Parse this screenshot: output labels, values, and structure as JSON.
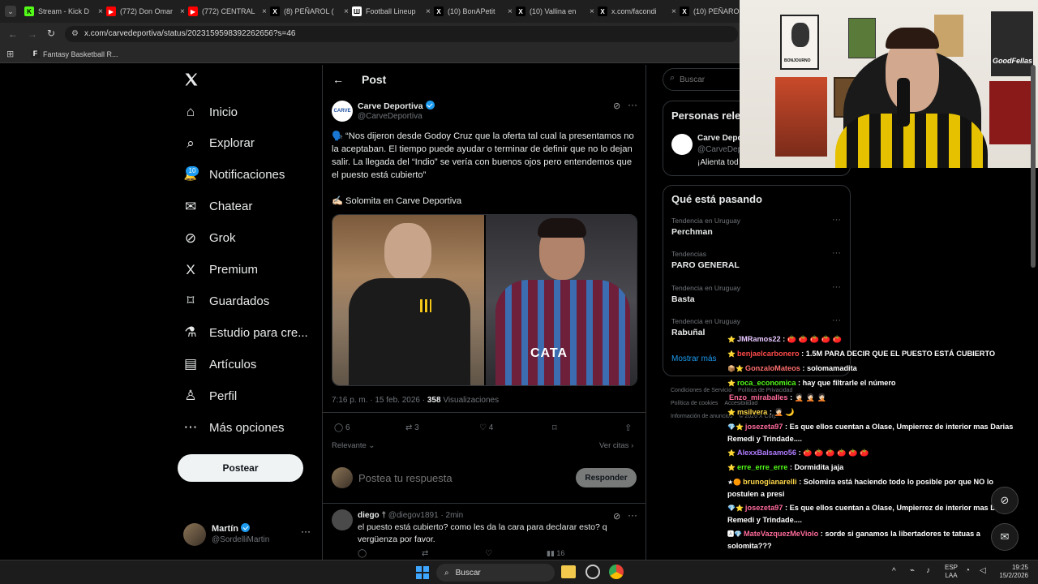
{
  "browser": {
    "tabs": [
      {
        "title": "Stream - Kick D",
        "color": "#53fc18",
        "glyph": "K"
      },
      {
        "title": "(772) Don Omar",
        "color": "#ff0000",
        "glyph": "▶"
      },
      {
        "title": "(772) CENTRAL",
        "color": "#ff0000",
        "glyph": "▶"
      },
      {
        "title": "(8) PEÑAROL (",
        "color": "#000000",
        "glyph": "X"
      },
      {
        "title": "Football Lineup",
        "color": "#ffffff",
        "glyph": "Ш"
      },
      {
        "title": "(10) BonAPetit",
        "color": "#000000",
        "glyph": "X"
      },
      {
        "title": "(10) Vallina en",
        "color": "#000000",
        "glyph": "X"
      },
      {
        "title": "x.com/facondi",
        "color": "#000000",
        "glyph": "X"
      },
      {
        "title": "(10) PEÑAROL",
        "color": "#000000",
        "glyph": "X"
      }
    ],
    "url": "x.com/carvedeportiva/status/2023159598392262656?s=46",
    "bookmark": "Fantasy Basketball R..."
  },
  "sidebar": {
    "items": [
      {
        "label": "Inicio",
        "icon": "home-icon",
        "name": "nav-inicio"
      },
      {
        "label": "Explorar",
        "icon": "search-icon",
        "name": "nav-explorar"
      },
      {
        "label": "Notificaciones",
        "icon": "bell-icon",
        "name": "nav-notificaciones"
      },
      {
        "label": "Chatear",
        "icon": "mail-icon",
        "name": "nav-chatear"
      },
      {
        "label": "Grok",
        "icon": "grok-icon",
        "name": "nav-grok"
      },
      {
        "label": "Premium",
        "icon": "x-logo-icon",
        "name": "nav-premium"
      },
      {
        "label": "Guardados",
        "icon": "bookmark-icon",
        "name": "nav-guardados"
      },
      {
        "label": "Estudio para cre...",
        "icon": "flask-icon",
        "name": "nav-estudio"
      },
      {
        "label": "Artículos",
        "icon": "article-icon",
        "name": "nav-articulos"
      },
      {
        "label": "Perfil",
        "icon": "person-icon",
        "name": "nav-perfil"
      },
      {
        "label": "Más opciones",
        "icon": "more-icon",
        "name": "nav-mas"
      }
    ],
    "notif_badge": "10",
    "post_button": "Postear",
    "account": {
      "name": "Martín",
      "handle": "@SordelliMartin"
    }
  },
  "post": {
    "header_title": "Post",
    "author": "Carve Deportiva",
    "handle": "@CarveDeportiva",
    "avatar_text": "CARVE",
    "body": "🗣️ “Nos dijeron desde Godoy Cruz que la oferta tal cual la presentamos no la aceptaban. El tiempo puede ayudar o terminar de definir que no lo dejan salir. La llegada del “Indio” se vería con buenos ojos pero entendemos que el puesto está cubierto”",
    "source": "✍🏻 Solomita en Carve Deportiva",
    "timestamp": "7:16 p. m. · 15 feb. 2026 · ",
    "views": "358",
    "views_label": " Visualizaciones",
    "replies": "6",
    "reposts": "3",
    "likes": "4",
    "sort_label": "Relevante",
    "quotes_link": "Ver citas",
    "reply_placeholder": "Postea tu respuesta",
    "reply_button": "Responder"
  },
  "reply": {
    "author": "diego",
    "mark": "†",
    "handle": "@diegov1891",
    "time": "· 2min",
    "text": "el puesto está cubierto? como les da la cara para declarar esto? q vergüenza por favor.",
    "views": "16"
  },
  "right": {
    "search_placeholder": "Buscar",
    "people_title": "Personas rele",
    "person_name": "Carve Depo",
    "person_handle": "@CarveDep",
    "person_bio": "¡Alienta tod",
    "trends_title": "Qué está pasando",
    "trends": [
      {
        "context": "Tendencia en Uruguay",
        "name": "Perchman"
      },
      {
        "context": "Tendencias",
        "name": "PARO GENERAL"
      },
      {
        "context": "Tendencia en Uruguay",
        "name": "Basta"
      },
      {
        "context": "Tendencia en Uruguay",
        "name": "Rabuñal"
      }
    ],
    "show_more": "Mostrar más",
    "footer": [
      "Condiciones de Servicio",
      "Política de Privacidad",
      "Política de cookies",
      "Accesibilidad",
      "Información de anuncios",
      "© 2026 X Corp."
    ]
  },
  "chat": [
    {
      "badge": "⭐",
      "user": "JMRamos22",
      "color": "#e8c7ff",
      "msg": "🍅 🍅 🍅 🍅 🍅"
    },
    {
      "badge": "⭐",
      "user": "benjaelcarbonero",
      "color": "#ff4a4a",
      "msg": "1.5M PARA DECIR QUE EL PUESTO ESTÁ CUBIERTO"
    },
    {
      "badge": "📦⭐",
      "user": "GonzaloMateos",
      "color": "#ff6f6f",
      "msg": "solomamadita"
    },
    {
      "badge": "⭐",
      "user": "roca_economica",
      "color": "#53fc18",
      "msg": "hay que filtrarle el número"
    },
    {
      "badge": "",
      "user": "Enzo_miraballes",
      "color": "#ff6b9b",
      "msg": "🤦🏻 🤦🏻 🤦🏻"
    },
    {
      "badge": "⭐",
      "user": "msilvera",
      "color": "#ffd84a",
      "msg": "🤦🏻 🌙"
    },
    {
      "badge": "💎⭐",
      "user": "josezeta97",
      "color": "#ff6b9b",
      "msg": "Es que ellos cuentan a Olase, Umpierrez de interior mas Darias Remedi y Trindade...."
    },
    {
      "badge": "⭐",
      "user": "AlexxBalsamo56",
      "color": "#b07cff",
      "msg": "🍅 🍅 🍅 🍅 🍅 🍅"
    },
    {
      "badge": "⭐",
      "user": "erre_erre_erre",
      "color": "#53fc18",
      "msg": "Dormidita jaja"
    },
    {
      "badge": "★🟠",
      "user": "brunogianarelli",
      "color": "#ffd84a",
      "msg": "Solomira está haciendo todo lo posible por que NO lo postulen a presi"
    },
    {
      "badge": "💎⭐",
      "user": "josezeta97",
      "color": "#ff6b9b",
      "msg": "Es que ellos cuentan a Olase, Umpierrez de interior mas Darias Remedi y Trindade...."
    },
    {
      "badge": "🅰💎",
      "user": "MateVazquezMeViolo",
      "color": "#ff6b9b",
      "msg": "sorde si ganamos la libertadores te tatuas a solomita???"
    }
  ],
  "taskbar": {
    "search": "Buscar",
    "lang1": "ESP",
    "lang2": "LAA",
    "time": "19:25",
    "date": "15/2/2026"
  }
}
